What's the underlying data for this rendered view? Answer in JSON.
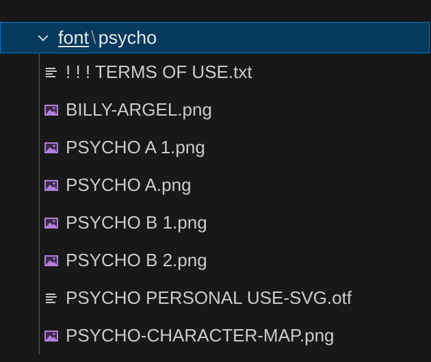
{
  "explorer": {
    "top_fragment": "˙ ˙",
    "folder": {
      "path_segment": "font",
      "separator": "\\",
      "name": "psycho",
      "expanded_icon": "chevron-down-icon"
    },
    "files": [
      {
        "name": "! ! ! TERMS OF USE.txt",
        "icon": "text-file-icon"
      },
      {
        "name": "BILLY-ARGEL.png",
        "icon": "image-file-icon"
      },
      {
        "name": "PSYCHO A 1.png",
        "icon": "image-file-icon"
      },
      {
        "name": "PSYCHO A.png",
        "icon": "image-file-icon"
      },
      {
        "name": "PSYCHO B 1.png",
        "icon": "image-file-icon"
      },
      {
        "name": "PSYCHO B 2.png",
        "icon": "image-file-icon"
      },
      {
        "name": "PSYCHO PERSONAL USE-SVG.otf",
        "icon": "text-file-icon"
      },
      {
        "name": "PSYCHO-CHARACTER-MAP.png",
        "icon": "image-file-icon"
      }
    ],
    "colors": {
      "background": "#181818",
      "selected_row": "#04395e",
      "focus_border": "#0078d4",
      "image_icon": "#b180d7",
      "text_icon": "#cccccc"
    }
  }
}
